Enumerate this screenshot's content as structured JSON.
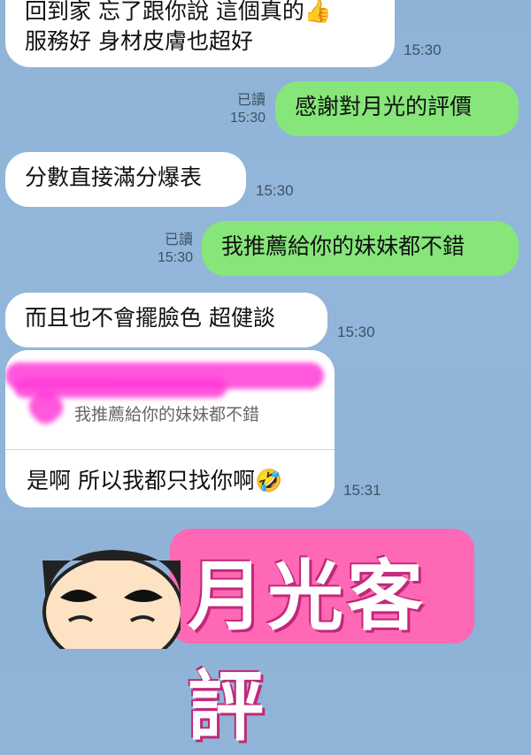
{
  "messages": [
    {
      "lines": [
        "回到家 忘了跟你說 這個真的👍",
        "服務好 身材皮膚也超好"
      ],
      "time": "15:30",
      "sender": "other"
    },
    {
      "text": "感謝對月光的評價",
      "time": "15:30",
      "read": "已讀",
      "sender": "me"
    },
    {
      "text": "分數直接滿分爆表",
      "time": "15:30",
      "sender": "other"
    },
    {
      "text": "我推薦給你的妹妹都不錯",
      "time": "15:30",
      "read": "已讀",
      "sender": "me"
    },
    {
      "text": "而且也不會擺臉色 超健談",
      "time": "15:30",
      "sender": "other"
    }
  ],
  "reply": {
    "quoted_text": "我推薦給你的妹妹都不錯",
    "text": "是啊 所以我都只找你啊🤣",
    "time": "15:31"
  },
  "sticker": {
    "text": "月光客評",
    "icon": "crayon-shin-chan-sticker"
  },
  "colors": {
    "background": "#8fb3d6",
    "incoming_bubble": "#ffffff",
    "outgoing_bubble": "#86e67a",
    "sticker_bg": "#ff68b4",
    "scribble": "#ff3bd8"
  }
}
